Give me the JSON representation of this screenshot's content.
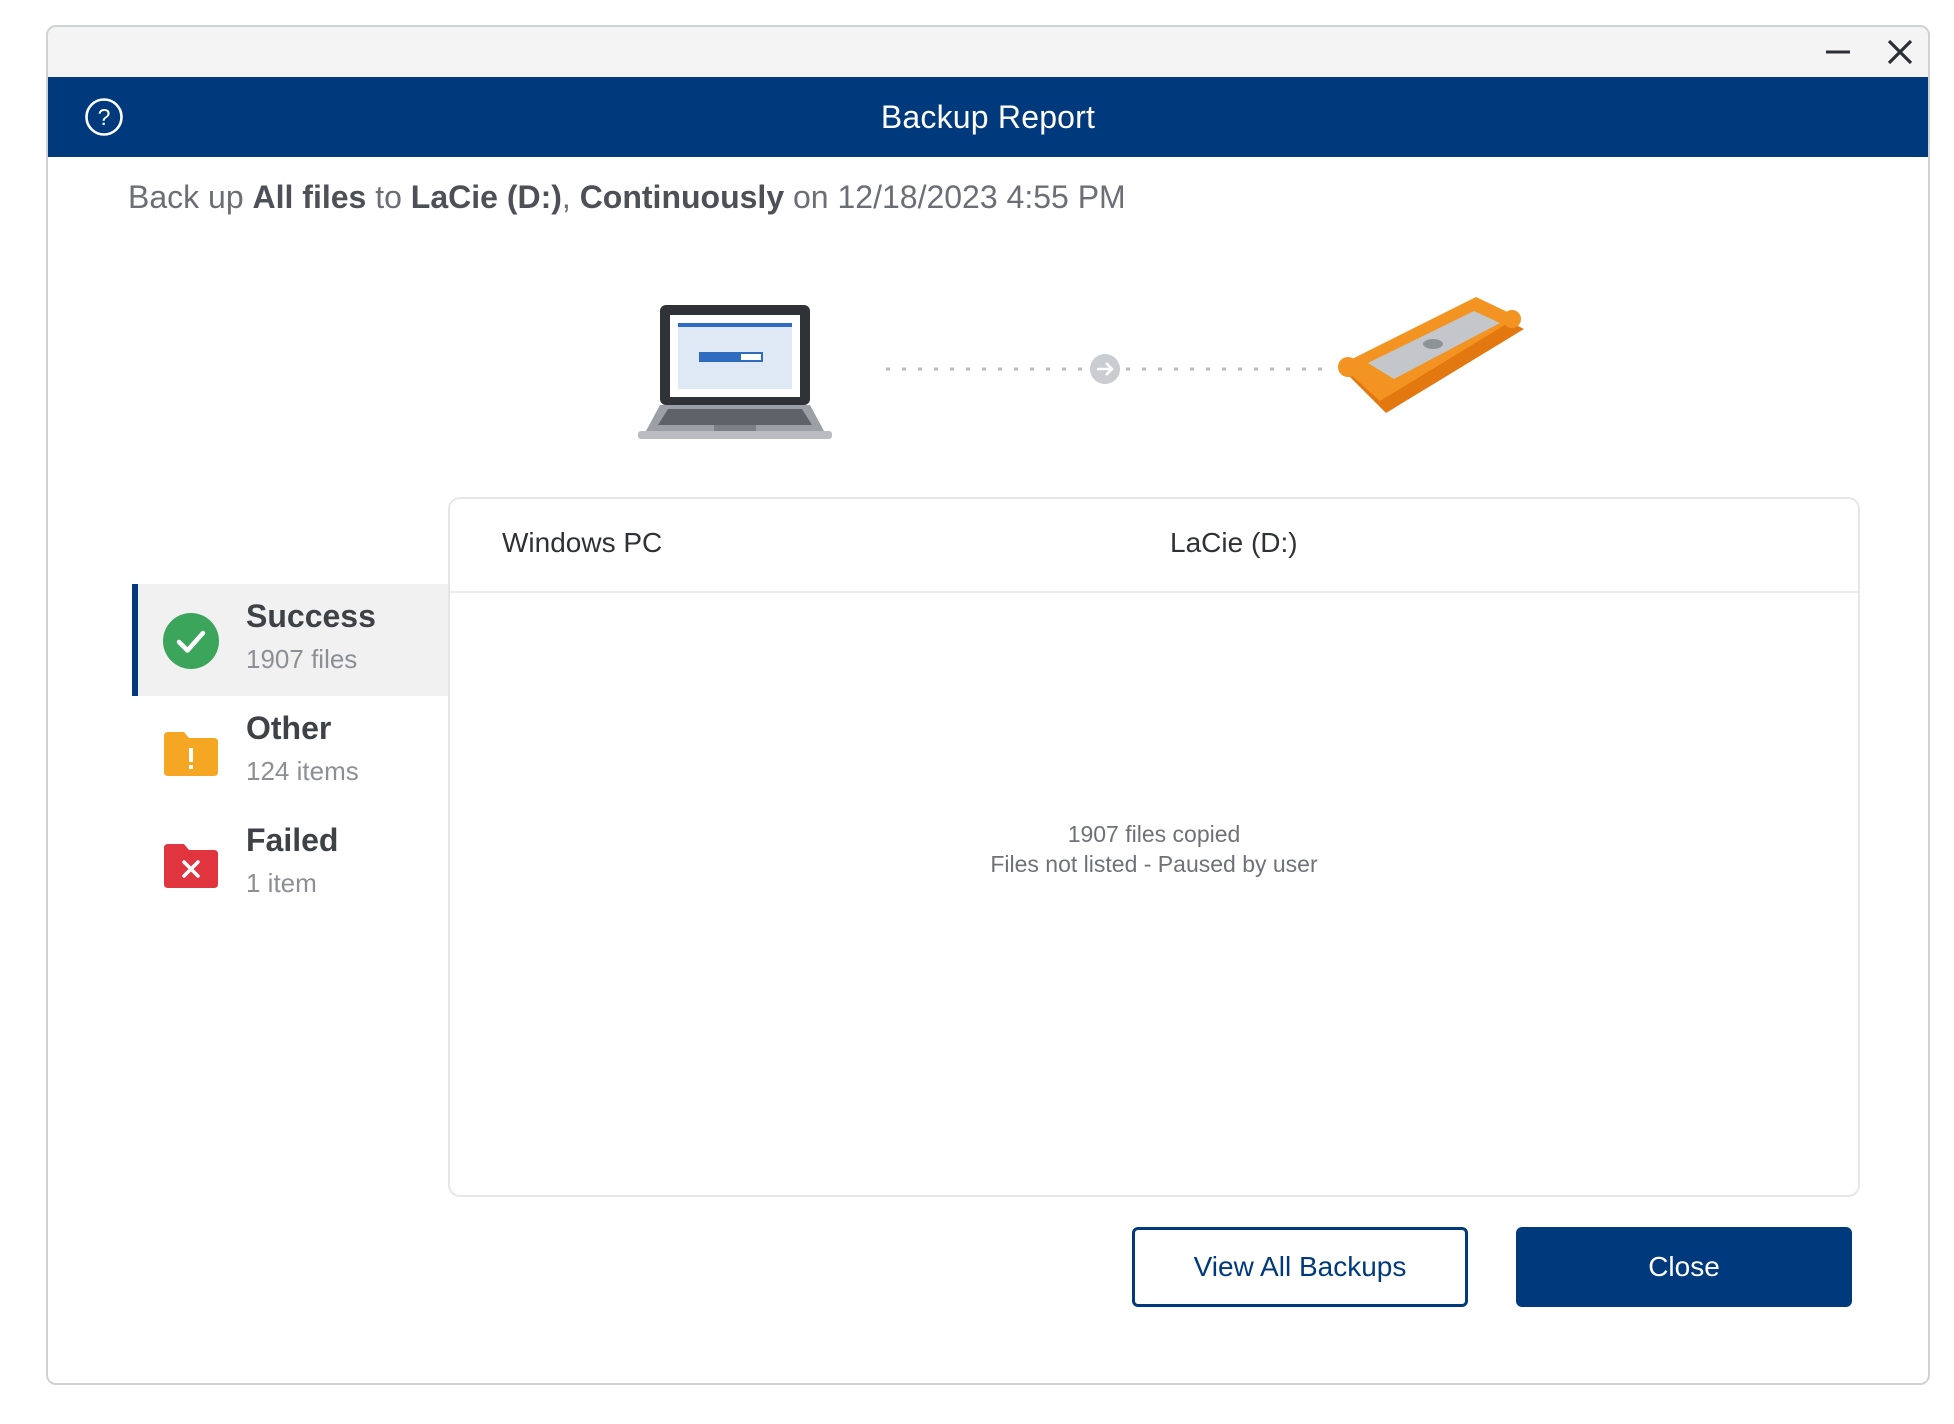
{
  "window": {
    "minimize_icon": "minimize-icon",
    "close_icon": "close-icon"
  },
  "header": {
    "title": "Backup Report",
    "help_icon": "help-circle-icon"
  },
  "summary": {
    "prefix": "Back up ",
    "what": "All files",
    "to_word": " to ",
    "destination": "LaCie (D:)",
    "comma": ", ",
    "schedule": "Continuously",
    "on_word": " on ",
    "datetime": "12/18/2023 4:55 PM"
  },
  "illustration": {
    "source_icon": "laptop-icon",
    "arrow_icon": "arrow-right-circle-icon",
    "destination_icon": "external-drive-icon"
  },
  "categories": [
    {
      "title": "Success",
      "count": "1907 files",
      "icon": "check-circle-icon",
      "color": "#3ba55c",
      "selected": true
    },
    {
      "title": "Other",
      "count": "124 items",
      "icon": "folder-warning-icon",
      "color": "#f5a623",
      "selected": false
    },
    {
      "title": "Failed",
      "count": "1 item",
      "icon": "folder-error-icon",
      "color": "#e0353f",
      "selected": false
    }
  ],
  "panel": {
    "source_column": "Windows PC",
    "destination_column": "LaCie (D:)",
    "message_line1": "1907 files copied",
    "message_line2": "Files not listed - Paused by user"
  },
  "buttons": {
    "view_all": "View All Backups",
    "close": "Close"
  },
  "colors": {
    "brand": "#003a7d",
    "drive_orange": "#f39322"
  }
}
